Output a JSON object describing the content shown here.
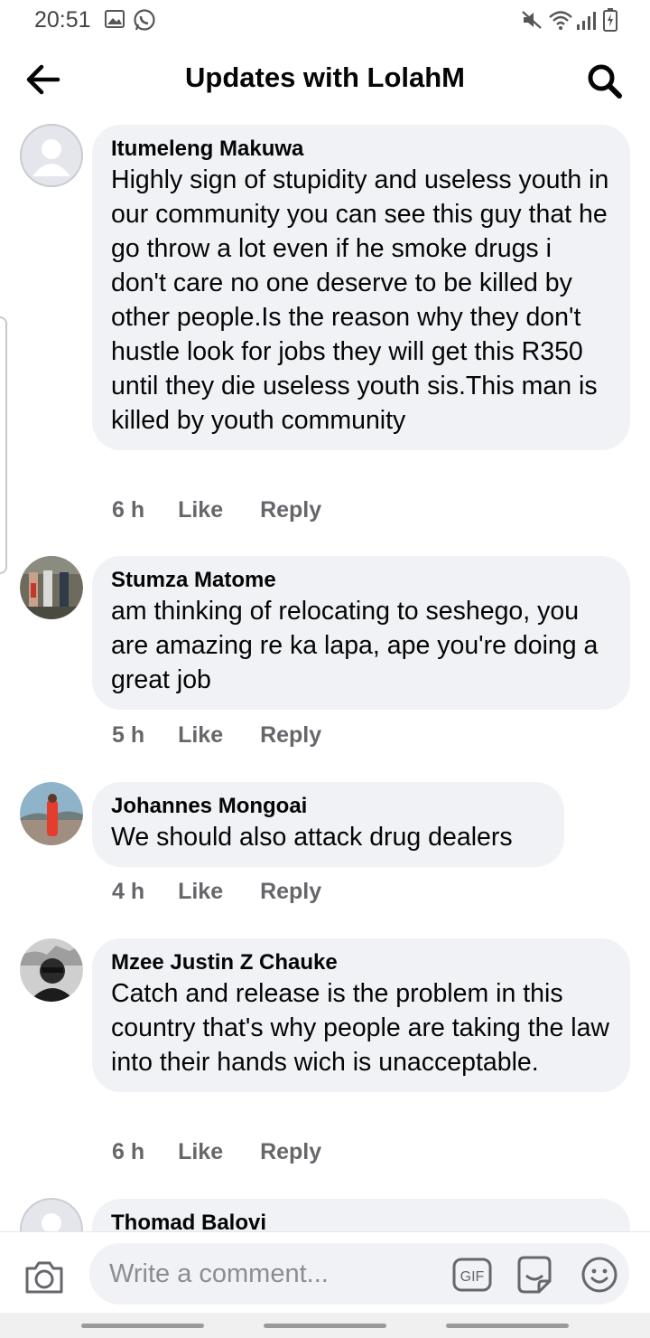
{
  "status_bar": {
    "time": "20:51",
    "icons": [
      "gallery-icon",
      "whatsapp-icon",
      "mute-icon",
      "wifi-icon",
      "signal-icon",
      "battery-icon"
    ]
  },
  "header": {
    "title": "Updates with LolahM",
    "back_icon": "back-arrow-icon",
    "search_icon": "search-icon"
  },
  "comments": [
    {
      "author": "Itumeleng Makuwa",
      "text": "Highly sign of stupidity and useless youth in our community you can see this guy that he go throw a lot even if he smoke drugs i don't care no one deserve to be killed by other people.Is the reason why they don't hustle look for jobs they will get this R350 until they die useless youth sis.This man is killed by youth community",
      "time": "6 h",
      "like": "Like",
      "reply": "Reply"
    },
    {
      "author": "Stumza Matome",
      "text": "am thinking of relocating to seshego, you are amazing re ka lapa, ape you're doing a great job",
      "time": "5 h",
      "like": "Like",
      "reply": "Reply"
    },
    {
      "author": "Johannes Mongoai",
      "text": "We should also attack drug dealers",
      "time": "4 h",
      "like": "Like",
      "reply": "Reply"
    },
    {
      "author": "Mzee Justin Z Chauke",
      "text": "Catch and release is the problem in this country that's why people are taking the law into their hands wich is unacceptable.",
      "time": "6 h",
      "like": "Like",
      "reply": "Reply"
    },
    {
      "author": "Thomad Balovi"
    }
  ],
  "composer": {
    "placeholder": "Write a comment...",
    "gif_label": "GIF"
  },
  "colors": {
    "bubble": "#f0f2f5",
    "meta_text": "#65676b",
    "primary_text": "#050505"
  }
}
